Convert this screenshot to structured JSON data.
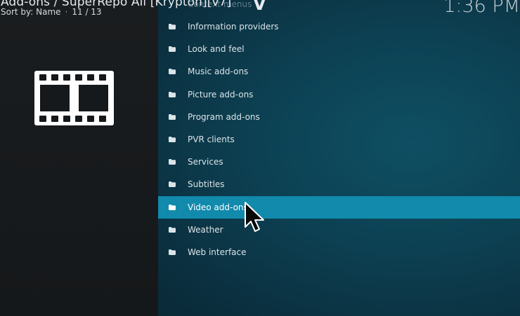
{
  "header": {
    "title": "Add-ons / SuperRepo All [Krypton][v7]",
    "sort_label": "Sort by: Name",
    "position": "11 / 13",
    "clock": "1:36 PM"
  },
  "ghost_item": "Context menus",
  "logo_letter": "V",
  "category_icon": "film-strip-icon",
  "menu": {
    "items": [
      {
        "label": "Information providers",
        "icon": "folder-icon"
      },
      {
        "label": "Look and feel",
        "icon": "folder-icon"
      },
      {
        "label": "Music add-ons",
        "icon": "folder-icon"
      },
      {
        "label": "Picture add-ons",
        "icon": "folder-icon"
      },
      {
        "label": "Program add-ons",
        "icon": "folder-icon"
      },
      {
        "label": "PVR clients",
        "icon": "folder-icon"
      },
      {
        "label": "Services",
        "icon": "folder-icon"
      },
      {
        "label": "Subtitles",
        "icon": "folder-icon"
      },
      {
        "label": "Video add-ons",
        "icon": "folder-icon"
      },
      {
        "label": "Weather",
        "icon": "folder-icon"
      },
      {
        "label": "Web interface",
        "icon": "folder-icon"
      }
    ],
    "selected_index": 8
  },
  "colors": {
    "selected_row": "#118aac",
    "background_left": "#16191b",
    "background_right": "#0c4052"
  }
}
